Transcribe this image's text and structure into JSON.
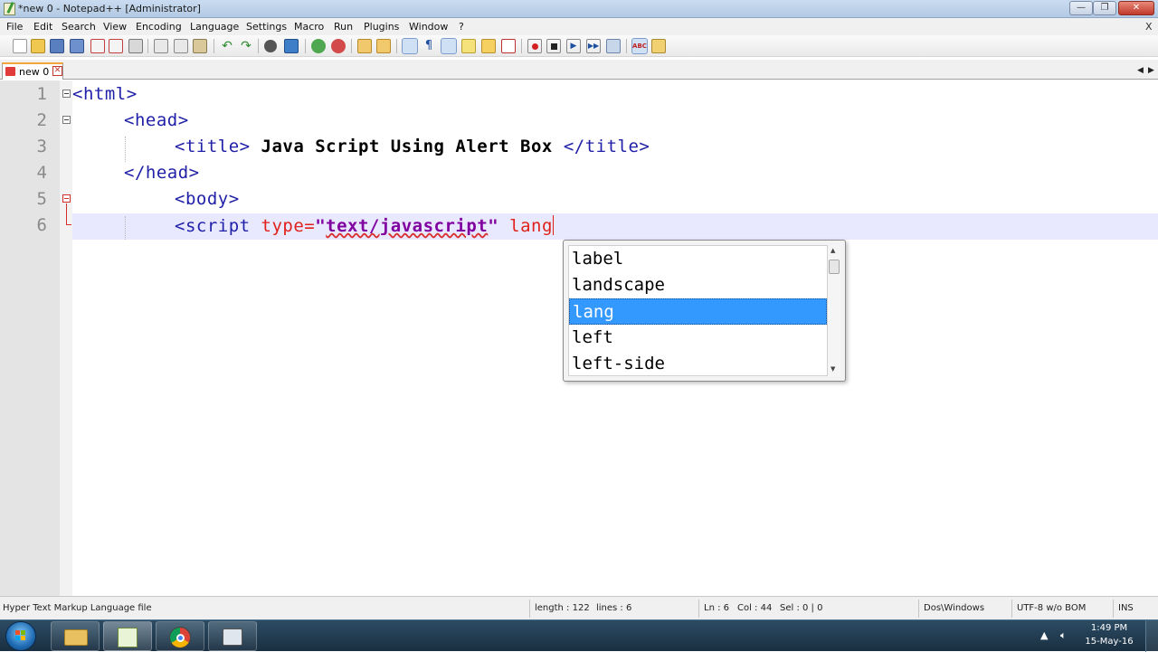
{
  "window": {
    "title": "*new  0 - Notepad++ [Administrator]"
  },
  "menu": [
    "File",
    "Edit",
    "Search",
    "View",
    "Encoding",
    "Language",
    "Settings",
    "Macro",
    "Run",
    "Plugins",
    "Window",
    "?"
  ],
  "menu_close": "X",
  "toolbar": {
    "icons": [
      "new-file-icon",
      "open-file-icon",
      "save-icon",
      "save-all-icon",
      "close-icon",
      "close-all-icon",
      "print-icon",
      "cut-icon",
      "copy-icon",
      "paste-icon",
      "undo-icon",
      "redo-icon",
      "find-icon",
      "replace-icon",
      "zoom-in-icon",
      "zoom-out-icon",
      "sync-vertical-icon",
      "sync-horizontal-icon",
      "word-wrap-icon",
      "show-all-characters-icon",
      "indent-guide-icon",
      "user-language-icon",
      "document-map-icon",
      "function-list-icon",
      "record-macro-icon",
      "stop-macro-icon",
      "play-macro-icon",
      "run-macro-multiple-icon",
      "save-macro-icon",
      "spell-check-icon",
      "spell-check-options-icon"
    ]
  },
  "tab": {
    "label": "new  0"
  },
  "editor": {
    "line_numbers": [
      "1",
      "2",
      "3",
      "4",
      "5",
      "6"
    ],
    "line1": {
      "open": "<ht",
      "cursor_gap": "m",
      "close": "l>"
    },
    "line2": {
      "text": "<head>"
    },
    "line3": {
      "open": "<title>",
      "content": " Java Script Using Alert Box ",
      "close": "</title>"
    },
    "line4": {
      "text": "</head>"
    },
    "line5": {
      "text": "<body>"
    },
    "line6": {
      "tag": "<script",
      "attr": " type=",
      "q1": "\"",
      "value": "text/javascript",
      "q2": "\"",
      "typed": " lang"
    }
  },
  "autocomplete": {
    "items": [
      "label",
      "landscape",
      "lang",
      "left",
      "left-side"
    ],
    "selected": "lang"
  },
  "status": {
    "file_type": "Hyper Text Markup Language file",
    "length": "length : 122",
    "lines": "lines : 6",
    "ln": "Ln : 6",
    "col": "Col : 44",
    "sel": "Sel : 0 | 0",
    "eol": "Dos\\Windows",
    "encoding": "UTF-8 w/o BOM",
    "mode": "INS"
  },
  "taskbar": {
    "apps": [
      "windows-explorer-icon",
      "notepad-plus-plus-icon",
      "chrome-icon",
      "screen-recorder-icon"
    ],
    "time": "1:49 PM",
    "date": "15-May-16"
  },
  "colors": {
    "tag": "#2020a8",
    "attribute": "#e0201a",
    "string": "#8000a0",
    "selection": "#3399ff",
    "current_line": "#e8e8ff"
  }
}
